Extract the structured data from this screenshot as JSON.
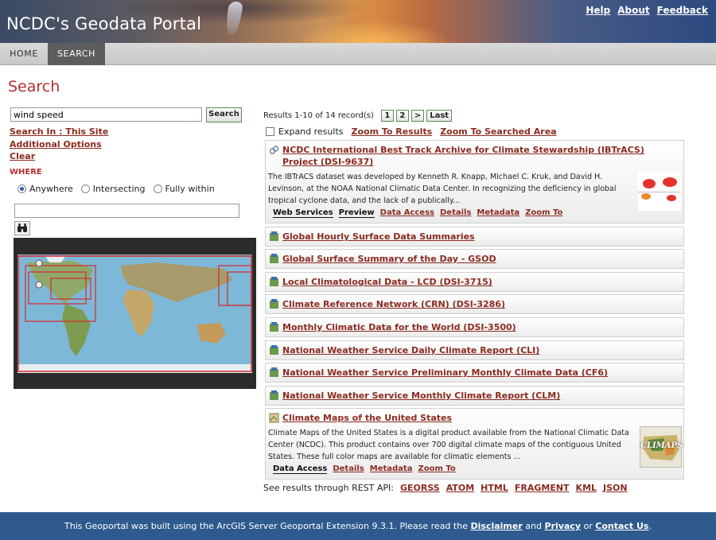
{
  "header": {
    "site_title": "NCDC's Geodata Portal",
    "links": [
      "Help",
      "About",
      "Feedback"
    ]
  },
  "nav": {
    "home": "HOME",
    "search": "SEARCH"
  },
  "page_title": "Search",
  "search": {
    "value": "wind speed",
    "button": "Search"
  },
  "side_links": {
    "search_in": "Search In : This Site",
    "additional": "Additional Options",
    "clear": "Clear"
  },
  "where": {
    "label": "WHERE",
    "options": [
      "Anywhere",
      "Intersecting",
      "Fully within"
    ],
    "selected": "Anywhere"
  },
  "results": {
    "info": "Results 1-10 of 14 record(s)",
    "pages": [
      "1",
      "2",
      ">",
      "Last"
    ],
    "expand_label": "Expand results",
    "zoom_results": "Zoom To Results",
    "zoom_area": "Zoom To Searched Area"
  },
  "records": [
    {
      "title": "NCDC International Best Track Archive for Climate Stewardship (IBTrACS) Project (DSI-9637)",
      "desc": [
        "The IBTrACS dataset was developed by Kenneth R. Knapp, Michael C. Kruk, and David H.",
        "Levinson, at the NOAA National Climatic Data Center. In recognizing the deficiency in global",
        "tropical cyclone data, and the lack of a publically..."
      ],
      "actions_plain": [
        "Web Services",
        "Preview"
      ],
      "actions_links": [
        "Data Access",
        "Details",
        "Metadata",
        "Zoom To"
      ]
    },
    {
      "title": "Global Hourly Surface Data Summaries"
    },
    {
      "title": "Global Surface Summary of the Day - GSOD"
    },
    {
      "title": "Local Climatological Data - LCD (DSI-3715)"
    },
    {
      "title": "Climate Reference Network (CRN) (DSI-3286)"
    },
    {
      "title": "Monthly Climatic Data for the World (DSI-3500)"
    },
    {
      "title": "National Weather Service Daily Climate Report (CLI)"
    },
    {
      "title": "National Weather Service Preliminary Monthly Climate Data (CF6)"
    },
    {
      "title": "National Weather Service Monthly Climate Report (CLM)"
    },
    {
      "title": "Climate Maps of the United States",
      "desc": [
        "Climate Maps of the United States is a digital product available from the National Climatic Data",
        "Center (NCDC). This product contains over 700 digital climate maps of the contiguous United",
        "States. These full color maps are available for climatic elements ..."
      ],
      "actions_links": [
        "Data Access",
        "Details",
        "Metadata",
        "Zoom To"
      ],
      "thumb_label": "CLIMAPS"
    }
  ],
  "rest": {
    "label": "See results through REST API:",
    "formats": [
      "GEORSS",
      "ATOM",
      "HTML",
      "FRAGMENT",
      "KML",
      "JSON"
    ]
  },
  "footer": {
    "pre": "This Geoportal was built using the ArcGIS Server Geoportal Extension 9.3.1. Please read the ",
    "disclaimer": "Disclaimer",
    "and": " and ",
    "privacy": "Privacy",
    "or": " or ",
    "contact": "Contact Us",
    "end": "."
  },
  "colors": {
    "accent": "#8b2b20",
    "title_red": "#b32f2f",
    "footer_blue": "#2e5a8e",
    "nav_active": "#5d5d5d"
  }
}
